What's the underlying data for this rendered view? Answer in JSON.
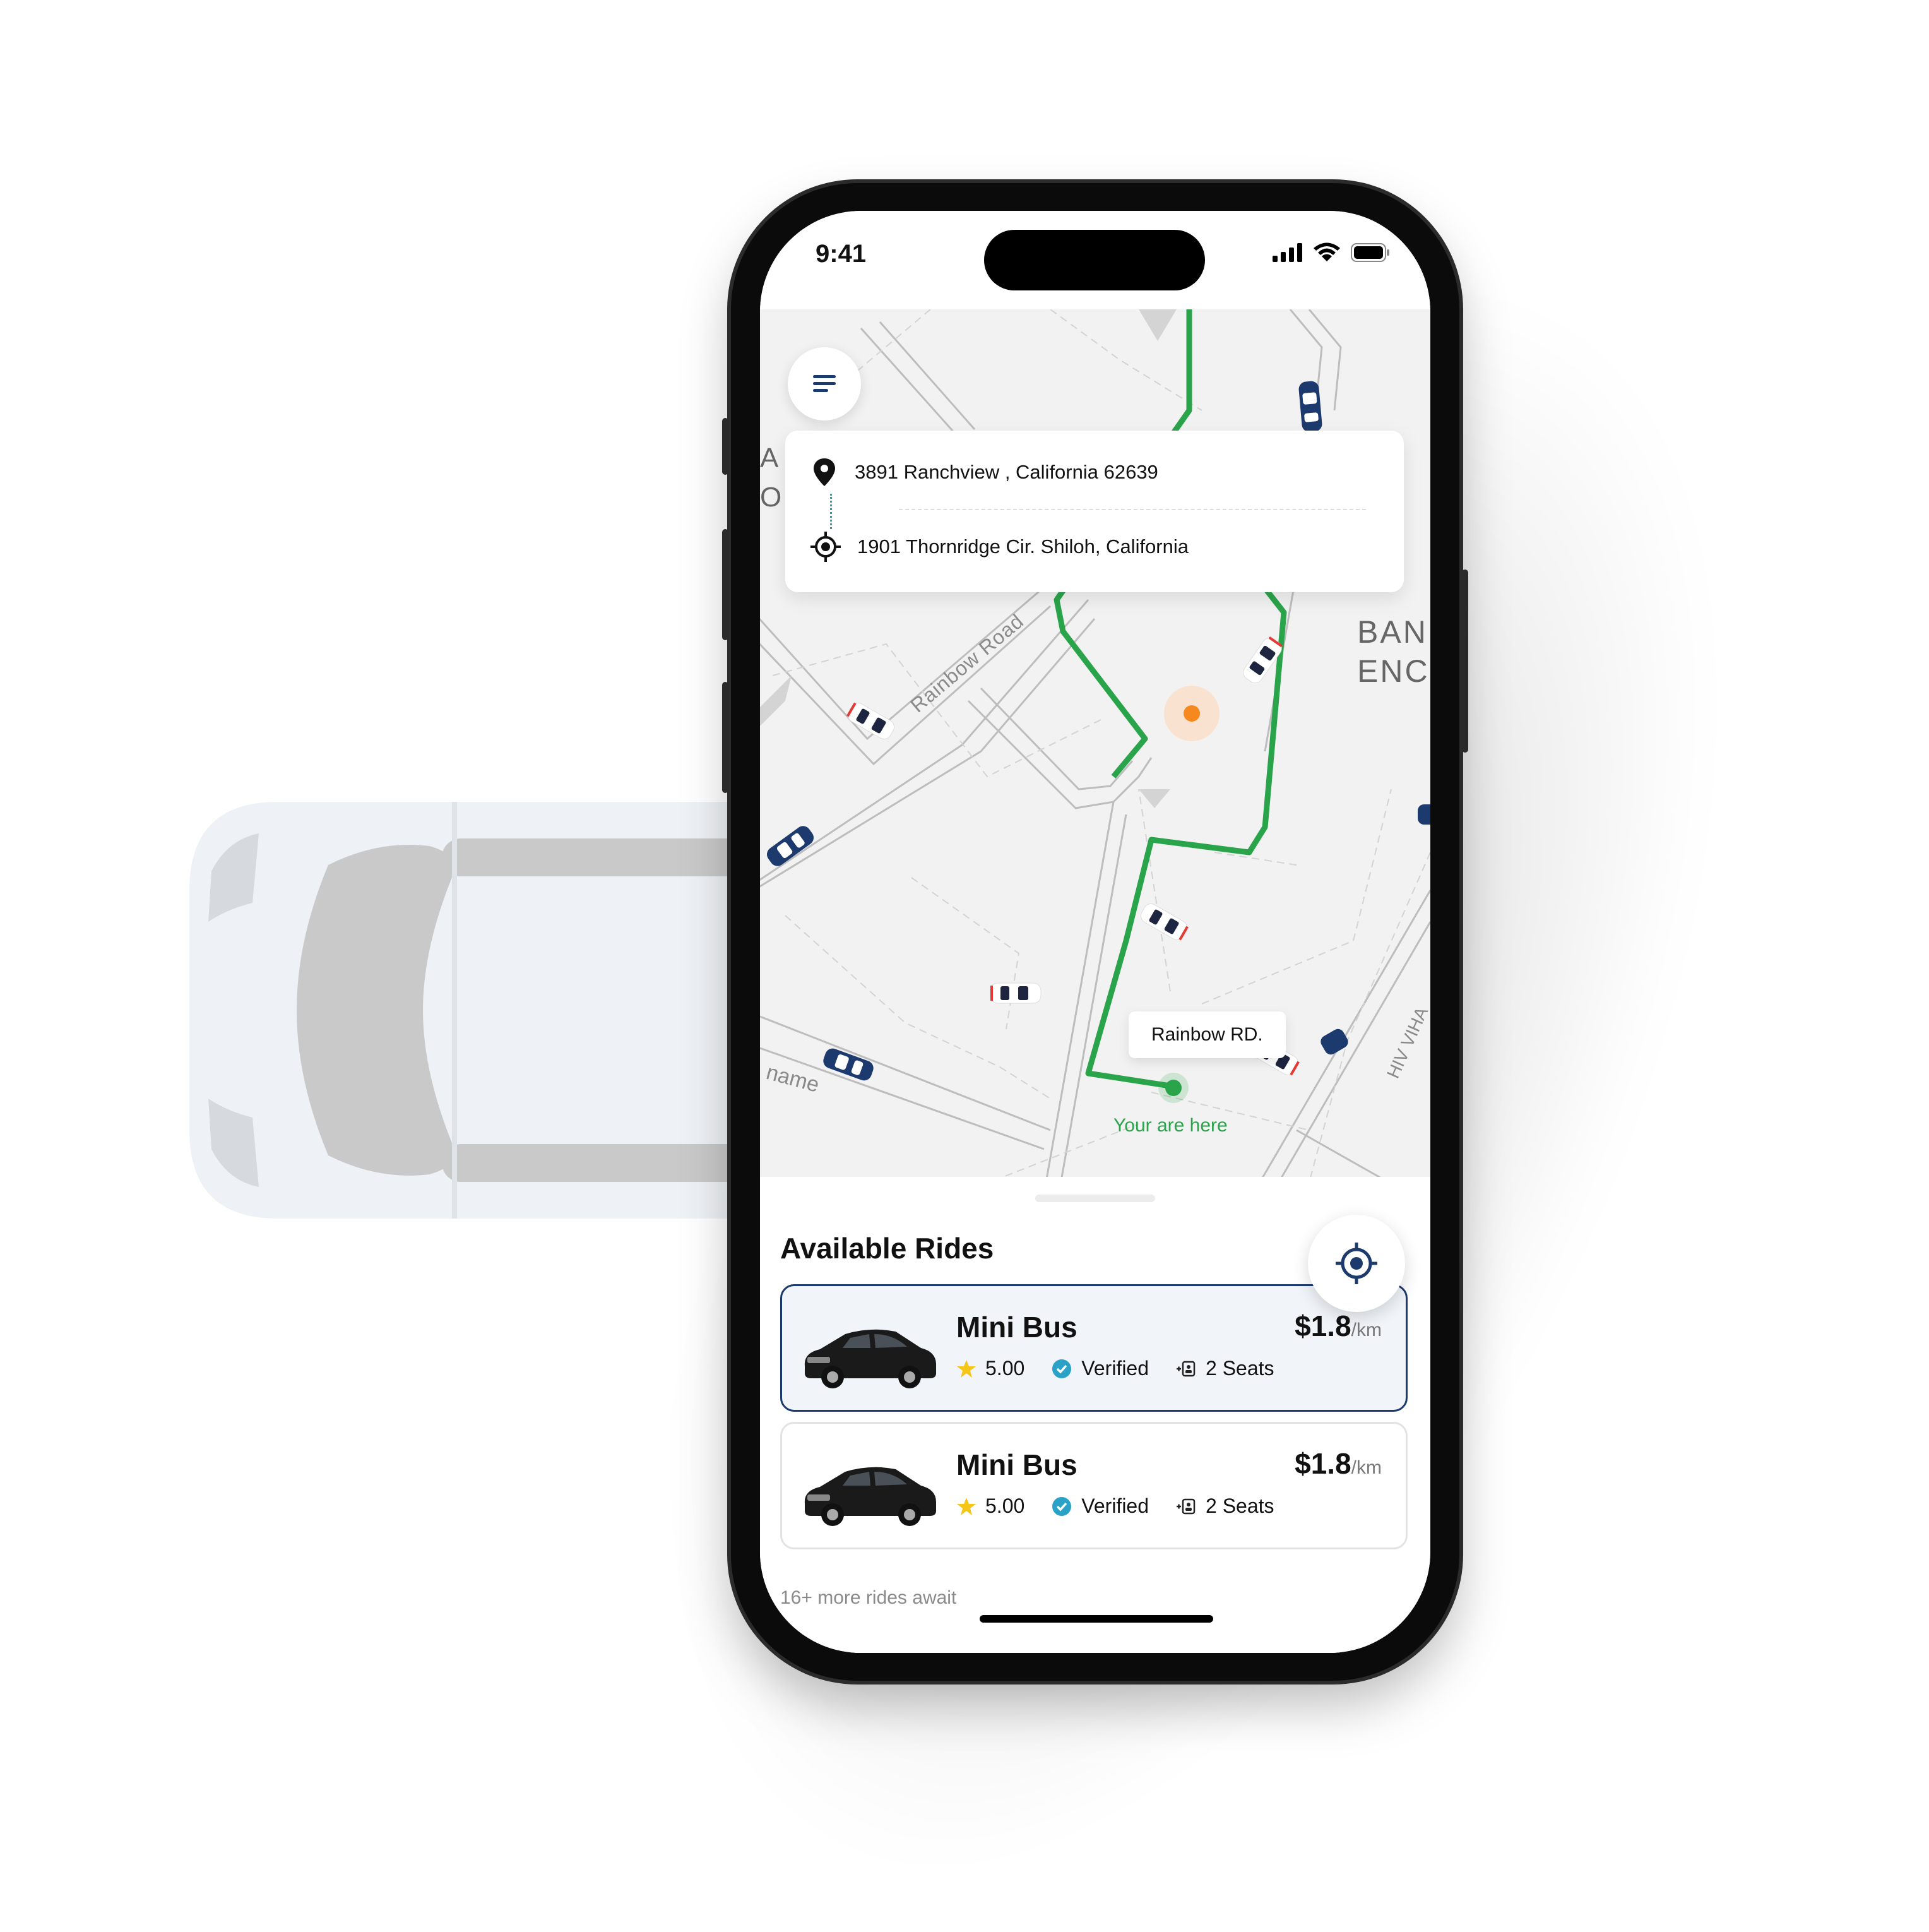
{
  "status_bar": {
    "time": "9:41"
  },
  "map": {
    "street_rainbow_road": "Rainbow Road",
    "street_name": "name",
    "area_left_top": "A",
    "area_left_bottom": "O",
    "area_right_1": "BAN",
    "area_right_2": "ENC",
    "area_right_road": "HIV VIHA",
    "destination_callout": "Rainbow RD.",
    "you_are_here": "Your are here",
    "route_color": "#2aa44a"
  },
  "route_card": {
    "pickup": "3891 Ranchview , California 62639",
    "dropoff": "1901 Thornridge Cir. Shiloh, California"
  },
  "rides": {
    "title": "Available Rides",
    "items": [
      {
        "name": "Mini Bus",
        "price": "$1.8",
        "unit": "/km",
        "rating": "5.00",
        "verified": "Verified",
        "seats": "2 Seats",
        "selected": true
      },
      {
        "name": "Mini Bus",
        "price": "$1.8",
        "unit": "/km",
        "rating": "5.00",
        "verified": "Verified",
        "seats": "2 Seats",
        "selected": false
      }
    ],
    "more": "16+ more rides await"
  },
  "colors": {
    "accent_navy": "#1d3a6e",
    "route_green": "#2aa44a",
    "star": "#f5c518",
    "verified": "#2aa1c7",
    "orange": "#f5891f"
  },
  "icons": [
    "menu-icon",
    "location-pin-icon",
    "target-icon",
    "locate-icon",
    "star-icon",
    "verified-icon",
    "seat-icon",
    "signal-icon",
    "wifi-icon",
    "battery-icon"
  ]
}
